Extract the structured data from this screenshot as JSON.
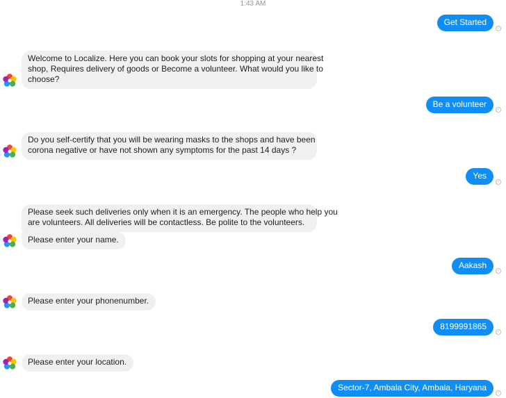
{
  "conversation": {
    "timestamp": "1:43 AM",
    "messages": [
      {
        "sender": "user",
        "text": "Get Started"
      },
      {
        "sender": "bot",
        "lines": [
          "Welcome to Localize. Here you can book your slots for shopping at your nearest",
          "shop, Requires delivery of goods or Become a volunteer. What would you like to",
          "choose?"
        ]
      },
      {
        "sender": "user",
        "text": "Be a volunteer"
      },
      {
        "sender": "bot",
        "lines": [
          "Do you self-certify that you will be wearing masks to the shops and have been",
          "corona negative or have not shown any symptoms for the past 14 days ?"
        ]
      },
      {
        "sender": "user",
        "text": "Yes"
      },
      {
        "sender": "bot",
        "lines": [
          "Please seek such deliveries only when it is an emergency. The people who help you",
          "are volunteers. All deliveries will be contactless. Be polite to the volunteers."
        ]
      },
      {
        "sender": "bot",
        "lines": [
          "Please enter your name."
        ]
      },
      {
        "sender": "user",
        "text": "Aakash"
      },
      {
        "sender": "bot",
        "lines": [
          "Please enter your phonenumber."
        ]
      },
      {
        "sender": "user",
        "text": "8199991865"
      },
      {
        "sender": "bot",
        "lines": [
          "Please enter your location."
        ]
      },
      {
        "sender": "user",
        "text": "Sector-7, Ambala City, Ambala, Haryana"
      }
    ]
  },
  "colors": {
    "user_bubble": "#0f8ff5",
    "bot_bubble": "#f1f0f0",
    "timestamp_text": "#90949c"
  },
  "icons": {
    "bot_avatar": "localize-logo-icon",
    "delivered": "read-receipt-check-icon"
  }
}
